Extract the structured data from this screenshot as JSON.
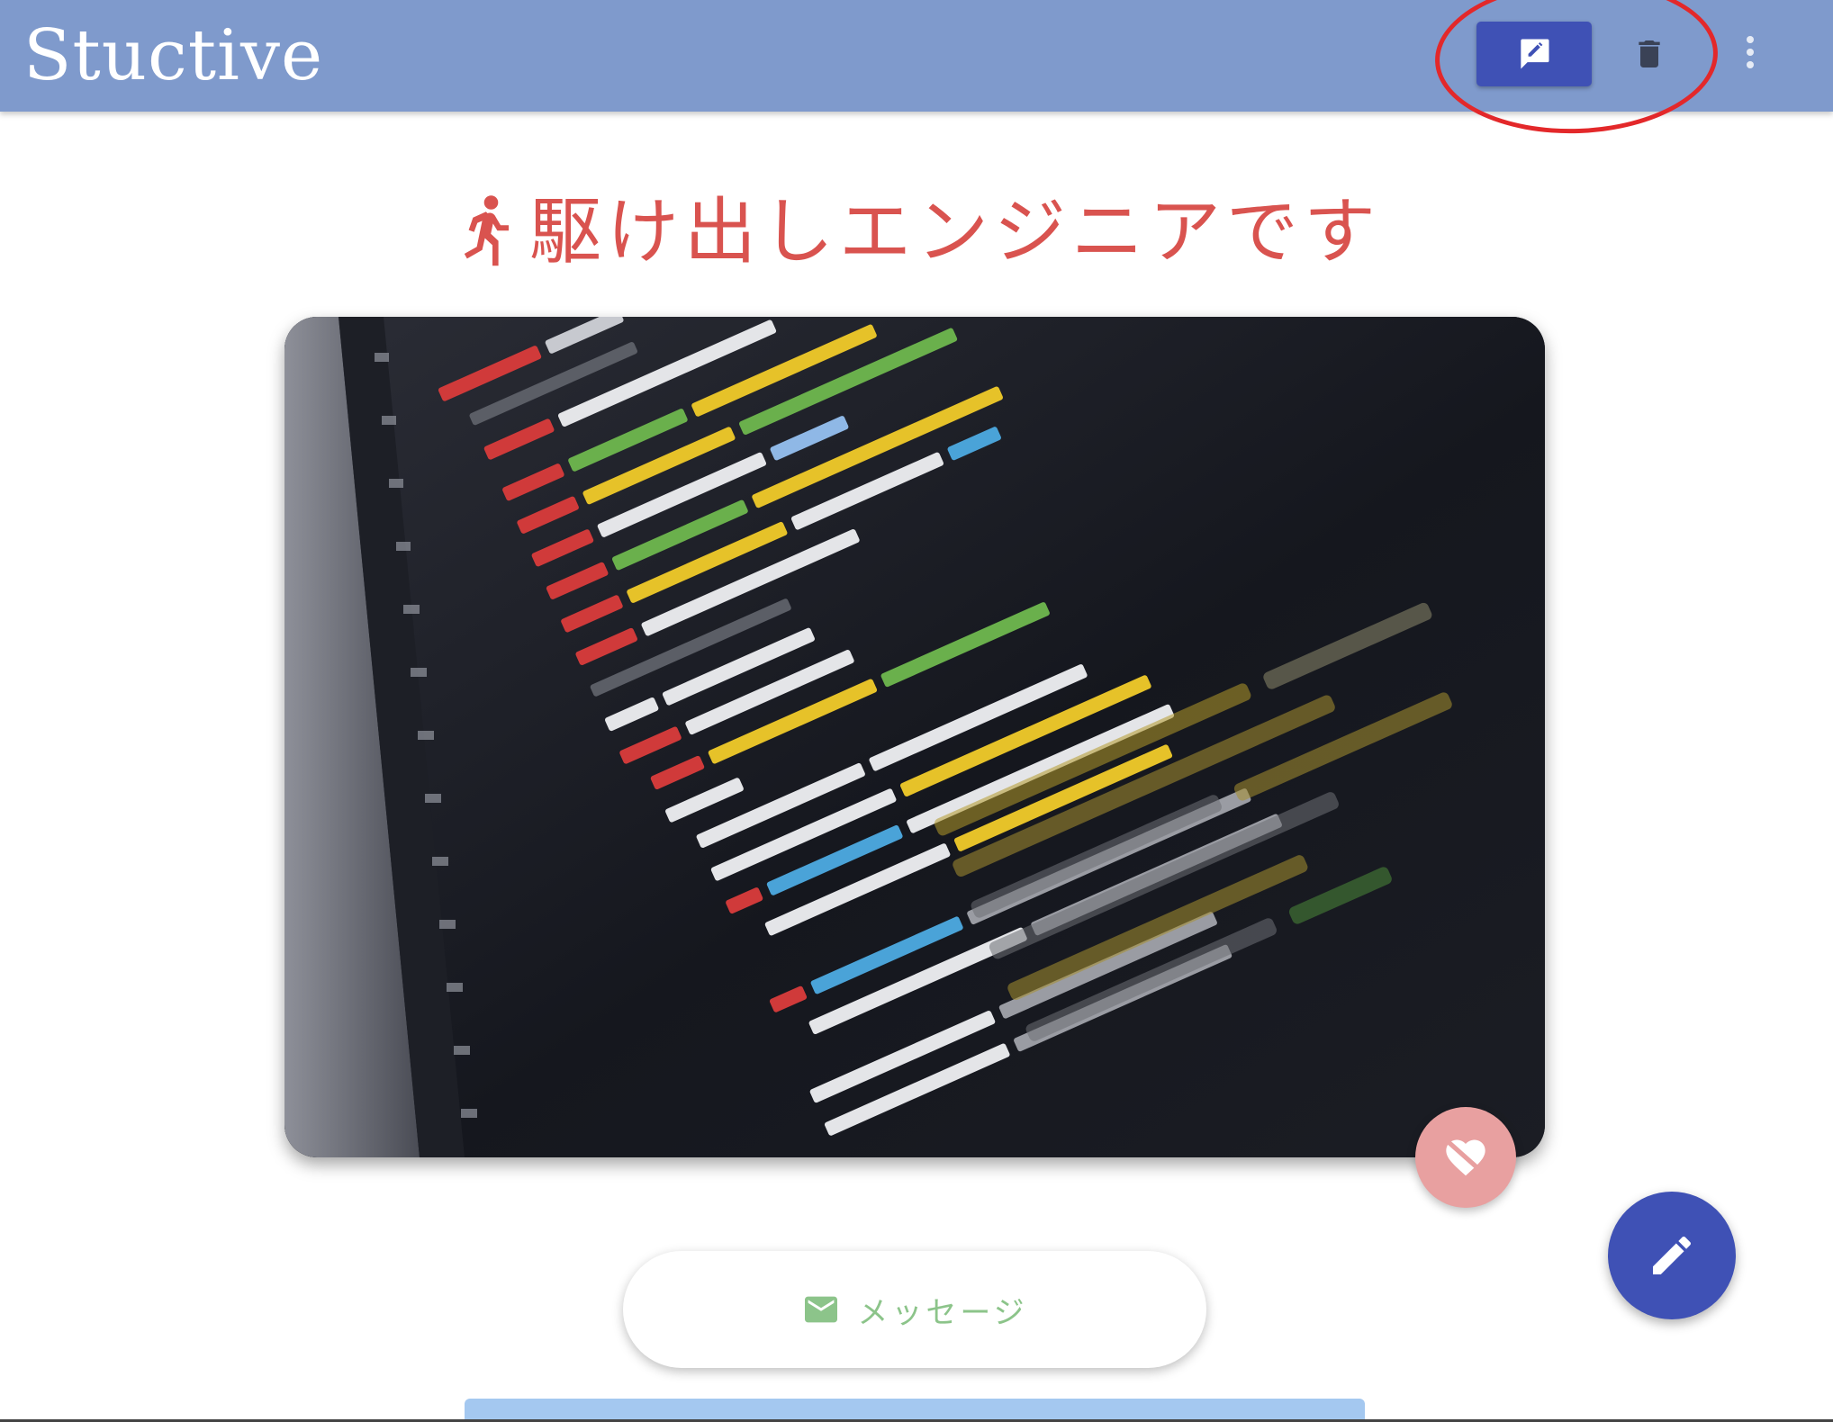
{
  "app": {
    "title": "Stuctive"
  },
  "toolbar": {
    "edit_icon": "edit-comment-icon",
    "delete_icon": "trash-icon",
    "more_icon": "more-vert-icon"
  },
  "profile": {
    "headline_icon": "running-person-icon",
    "headline": "駆け出しエンジニアです",
    "image_icon": "code-screen-photo"
  },
  "actions": {
    "like_icon": "heart-broken-icon",
    "message_label": "メッセージ",
    "message_icon": "mail-icon",
    "edit_fab_icon": "pencil-icon"
  },
  "colors": {
    "app_bar": "#7f9acc",
    "primary": "#3f51b5",
    "headline": "#d9534f",
    "like": "#e8a0a0",
    "message_text": "#8cc48a",
    "annotation": "#e3282a",
    "bottom_strip": "#a4c8f0"
  }
}
